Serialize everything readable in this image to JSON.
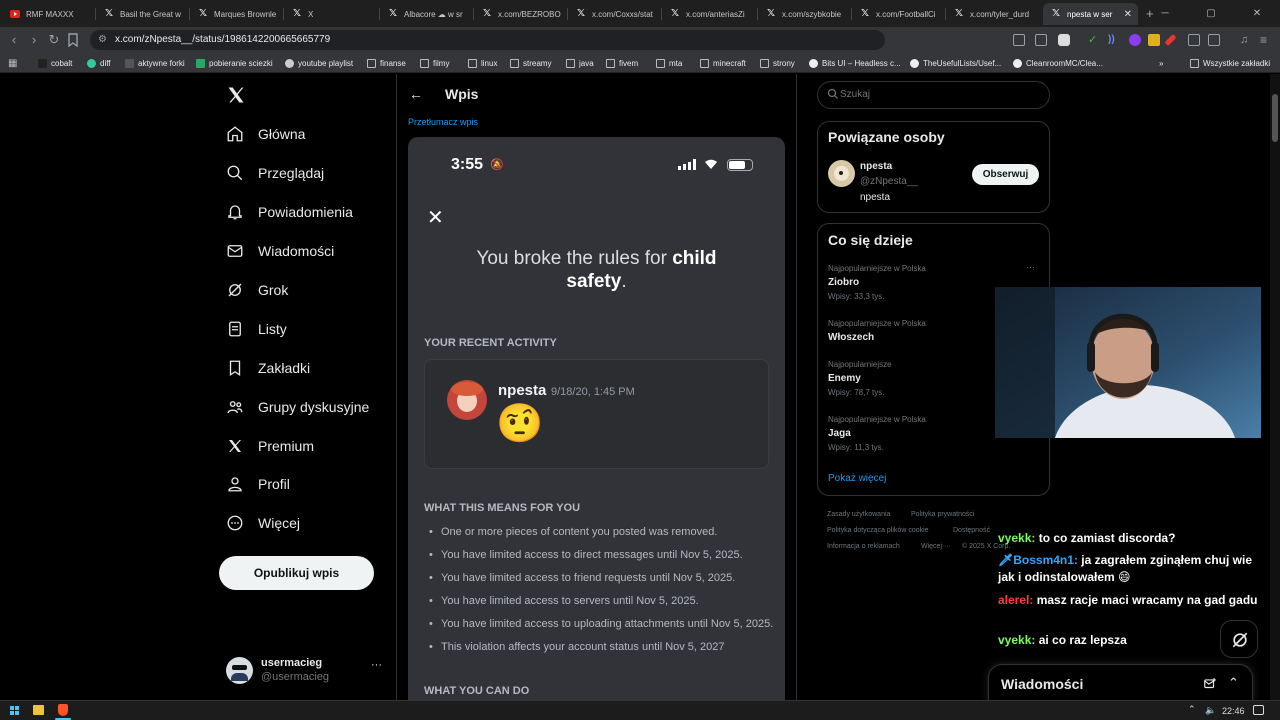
{
  "browser": {
    "tabs": [
      {
        "title": "RMF MAXXX",
        "icon": "rmf-play-icon"
      },
      {
        "title": "Basil the Great w",
        "icon": "x-logo-icon"
      },
      {
        "title": "Marques Brownle",
        "icon": "x-logo-icon"
      },
      {
        "title": "X",
        "icon": "x-logo-icon"
      },
      {
        "title": "Albacore ☁ w sr",
        "icon": "x-logo-icon"
      },
      {
        "title": "x.com/BEZROBO",
        "icon": "x-logo-icon"
      },
      {
        "title": "x.com/Coxxs/stat",
        "icon": "x-logo-icon"
      },
      {
        "title": "x.com/anteriasZi",
        "icon": "x-logo-icon"
      },
      {
        "title": "x.com/szybkobie",
        "icon": "x-logo-icon"
      },
      {
        "title": "x.com/FootballCi",
        "icon": "x-logo-icon"
      },
      {
        "title": "x.com/tyler_durd",
        "icon": "x-logo-icon"
      },
      {
        "title": "npesta w ser",
        "icon": "x-logo-icon",
        "active": true
      }
    ],
    "url": "x.com/zNpesta__/status/1986142200665665779",
    "bookmarks": [
      {
        "label": "cobalt"
      },
      {
        "label": "diff"
      },
      {
        "label": "aktywne forki"
      },
      {
        "label": "pobieranie sciezki"
      },
      {
        "label": "youtube playlist"
      },
      {
        "label": "finanse"
      },
      {
        "label": "filmy"
      },
      {
        "label": "linux"
      },
      {
        "label": "streamy"
      },
      {
        "label": "java"
      },
      {
        "label": "fivem"
      },
      {
        "label": "mta"
      },
      {
        "label": "minecraft"
      },
      {
        "label": "strony"
      },
      {
        "label": "Bits UI – Headless c..."
      },
      {
        "label": "TheUsefulLists/Usef..."
      },
      {
        "label": "CleanroomMC/Clea..."
      }
    ],
    "bookmarks_more": "»",
    "all_bookmarks": "Wszystkie zakładki"
  },
  "sidebar": {
    "items": [
      {
        "label": "Główna",
        "icon": "home-icon"
      },
      {
        "label": "Przeglądaj",
        "icon": "search-icon"
      },
      {
        "label": "Powiadomienia",
        "icon": "bell-icon"
      },
      {
        "label": "Wiadomości",
        "icon": "envelope-icon"
      },
      {
        "label": "Grok",
        "icon": "grok-icon"
      },
      {
        "label": "Listy",
        "icon": "list-icon"
      },
      {
        "label": "Zakładki",
        "icon": "bookmark-icon"
      },
      {
        "label": "Grupy dyskusyjne",
        "icon": "communities-icon"
      },
      {
        "label": "Premium",
        "icon": "x-logo-icon"
      },
      {
        "label": "Profil",
        "icon": "person-icon"
      },
      {
        "label": "Więcej",
        "icon": "more-circle-icon"
      }
    ],
    "post_button": "Opublikuj wpis",
    "account": {
      "name": "usermacieg",
      "handle": "@usermacieg",
      "more": "···"
    }
  },
  "main": {
    "header": "Wpis",
    "translate_link": "Przetłumacz wpis",
    "phone": {
      "time": "3:55",
      "headline_prefix": "You broke the rules for ",
      "headline_bold": "child safety",
      "headline_suffix": ".",
      "recent_activity": "YOUR RECENT ACTIVITY",
      "message": {
        "author": "npesta",
        "timestamp": "9/18/20, 1:45 PM",
        "emoji": "🤨"
      },
      "means_title": "WHAT THIS MEANS FOR YOU",
      "means_items": [
        "One or more pieces of content you posted was removed.",
        "You have limited access to direct messages until Nov 5, 2025.",
        "You have limited access to friend requests until Nov 5, 2025.",
        "You have limited access to servers until Nov 5, 2025.",
        "You have limited access to uploading attachments until Nov 5, 2025.",
        "This violation affects your account status until Nov 5, 2027"
      ],
      "can_do_title": "WHAT YOU CAN DO"
    }
  },
  "right": {
    "search_placeholder": "Szukaj",
    "related": {
      "title": "Powiązane osoby",
      "name": "npesta",
      "handle": "@zNpesta__",
      "bio": "npesta",
      "follow": "Obserwuj"
    },
    "trends": {
      "title": "Co się dzieje",
      "items": [
        {
          "category": "Najpopularniejsze w Polska",
          "name": "Ziobro",
          "count": "Wpisy: 33,3 tys."
        },
        {
          "category": "Najpopularniejsze w Polska",
          "name": "Włoszech",
          "count": ""
        },
        {
          "category": "Najpopularniejsze",
          "name": "Enemy",
          "count": "Wpisy: 78,7 tys."
        },
        {
          "category": "Najpopularniejsze w Polska",
          "name": "Jaga",
          "count": "Wpisy: 11,3 tys."
        }
      ],
      "more": "···",
      "show_more": "Pokaż więcej"
    },
    "footer": {
      "line1": [
        "Zasady użytkowania",
        "Polityka prywatności"
      ],
      "line2": [
        "Polityka dotycząca plików cookie",
        "Dostępność"
      ],
      "line3": [
        "Informacja o reklamach",
        "Więcej ···",
        "© 2025 X Corp."
      ]
    }
  },
  "chat": [
    {
      "user": "vyekk:",
      "text": "to co zamiast discorda?",
      "color": "#7cfc5c"
    },
    {
      "user": "Bossm4n1:",
      "text": "ja zagrałem zginąłem chuj wie jak i odinstalowałem 😄",
      "color": "#2ea8ff"
    },
    {
      "user": "alerel:",
      "text": "masz racje maci wracamy na gad gadu",
      "color": "#ff3b3b"
    },
    {
      "user": "vyekk:",
      "text": "ai co raz lepsza",
      "color": "#7cfc5c"
    }
  ],
  "messages_bar": {
    "label": "Wiadomości"
  },
  "taskbar": {
    "time": "22:46"
  }
}
